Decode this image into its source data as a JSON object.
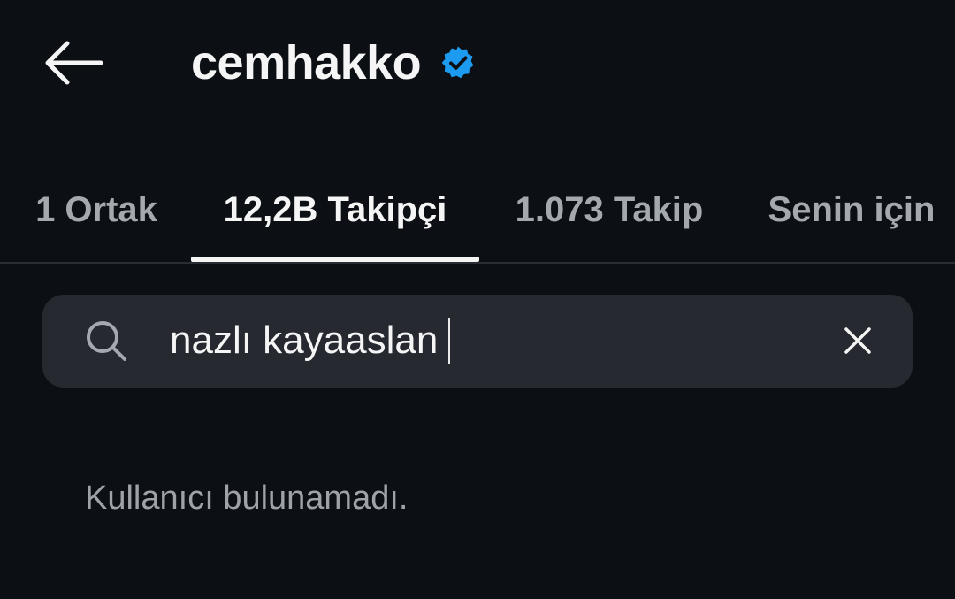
{
  "header": {
    "back_icon": "arrow-left-icon",
    "username": "cemhakko",
    "verified_icon": "verified-badge-icon",
    "verified_color": "#1d9bf0"
  },
  "tabs": [
    {
      "label": "1 Ortak",
      "active": false
    },
    {
      "label": "12,2B Takipçi",
      "active": true
    },
    {
      "label": "1.073 Takip",
      "active": false
    },
    {
      "label": "Senin için",
      "active": false
    }
  ],
  "search": {
    "icon": "search-icon",
    "value": "nazlı kayaaslan",
    "clear_icon": "close-icon"
  },
  "result": {
    "empty_message": "Kullanıcı bulunamadı."
  },
  "colors": {
    "background": "#0c0f14",
    "search_bg": "#26292f",
    "text_primary": "#f5f5f5",
    "text_muted": "#a4a9b0"
  }
}
